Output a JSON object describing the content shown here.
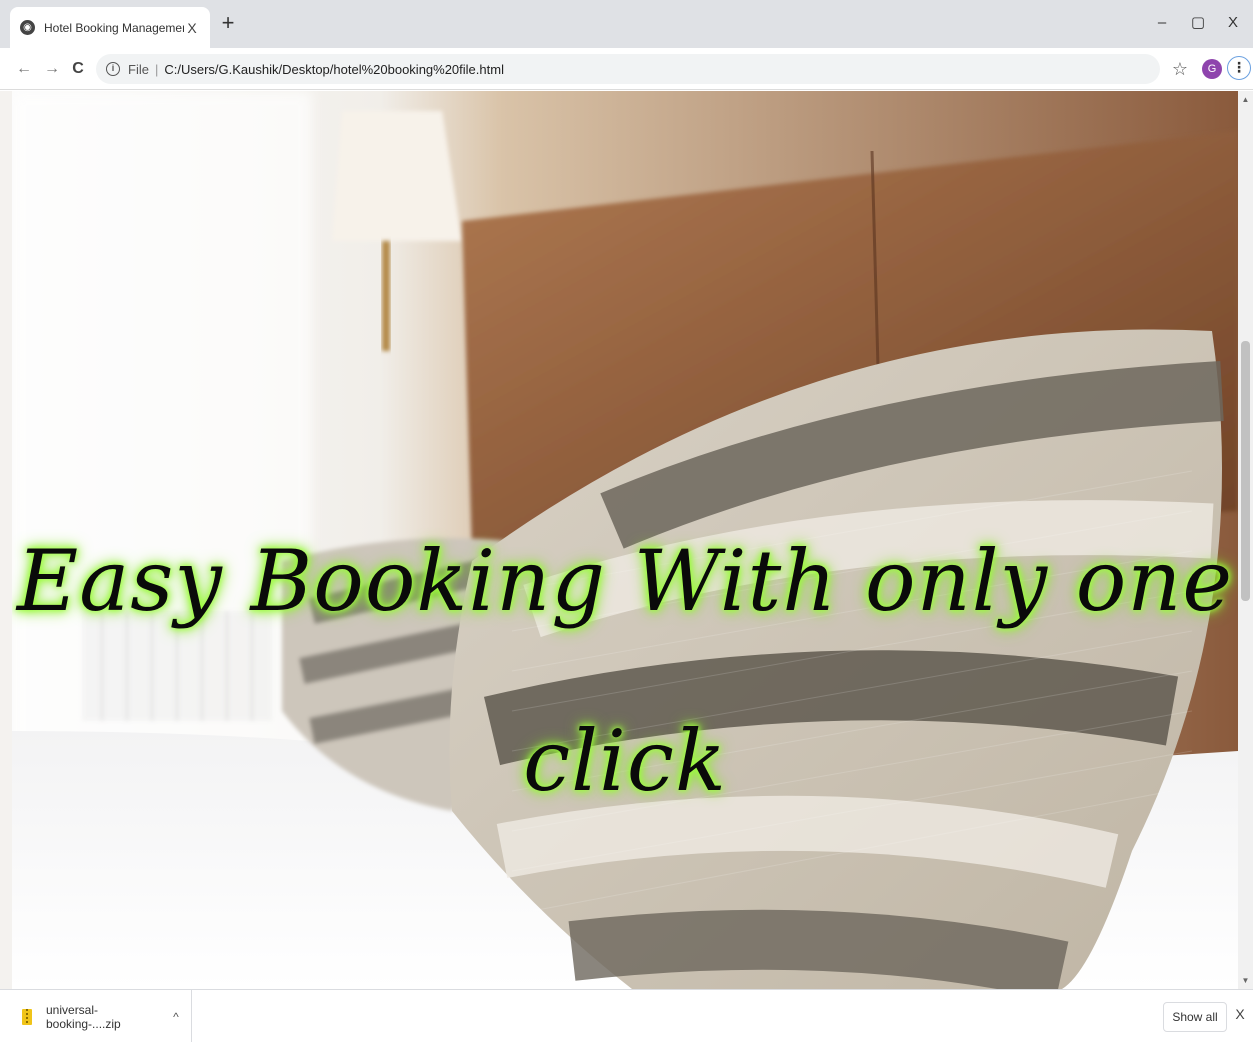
{
  "browser": {
    "tab": {
      "title": "Hotel Booking Management",
      "favicon": "globe-icon",
      "close_glyph": "X"
    },
    "new_tab_glyph": "+",
    "window_controls": {
      "minimize": "–",
      "maximize": "▢",
      "close": "X"
    },
    "nav": {
      "back": "←",
      "forward": "→",
      "reload": "C"
    },
    "omnibox": {
      "scheme": "File",
      "separator": "|",
      "url": "C:/Users/G.Kaushik/Desktop/hotel%20booking%20file.html"
    },
    "bookmark_glyph": "☆",
    "profile_initial": "G",
    "menu_glyph": "⋮",
    "accent_color": "#8e44ad"
  },
  "page": {
    "headline": "Easy Booking With only one click",
    "glow_color": "#9cff3a"
  },
  "downloads": {
    "item_name": "universal-booking-....zip",
    "chevron": "^",
    "show_all": "Show all",
    "close_glyph": "X"
  }
}
